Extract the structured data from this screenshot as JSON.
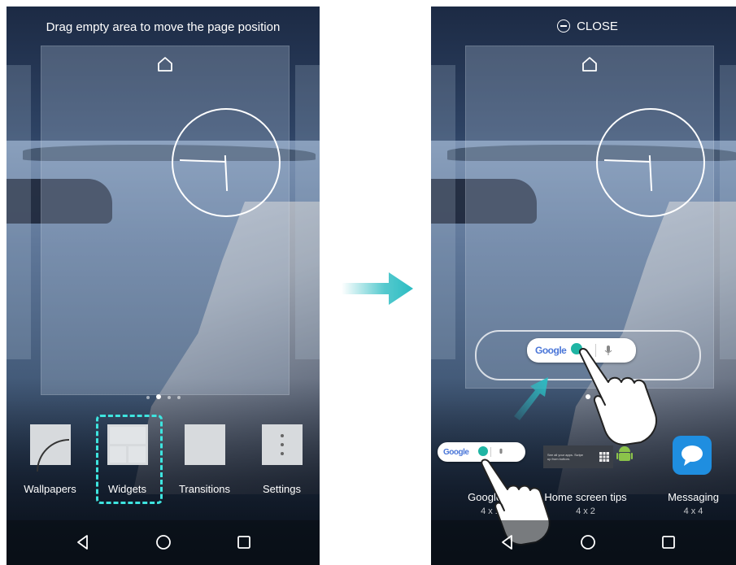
{
  "left_screen": {
    "hint": "Drag empty area to move the page position",
    "options": [
      {
        "label": "Wallpapers",
        "icon": "wallpaper-icon"
      },
      {
        "label": "Widgets",
        "icon": "widgets-icon",
        "highlighted": true
      },
      {
        "label": "Transitions",
        "icon": "transitions-icon"
      },
      {
        "label": "Settings",
        "icon": "settings-icon"
      }
    ],
    "page_count": 4,
    "active_page": 2
  },
  "right_screen": {
    "close_label": "CLOSE",
    "widgets": [
      {
        "label": "Google Q",
        "size": "4 x 1",
        "icon": "google-search-bar-icon"
      },
      {
        "label": "Home screen tips",
        "size": "4 x 2",
        "icon": "home-screen-tips-icon"
      },
      {
        "label": "Messaging",
        "size": "4 x 4",
        "icon": "messaging-icon"
      }
    ],
    "search_logo": "Google",
    "tips_text": "See all your apps. Swipe up from bottom."
  },
  "colors": {
    "highlight": "#3ee4df",
    "arrow": "#2bbcc2",
    "touch_dot": "#1fb5a4"
  },
  "icons": [
    "home-icon",
    "back-icon",
    "home-nav-icon",
    "recents-icon",
    "minus-circle-icon",
    "clock-widget-icon",
    "search-icon",
    "mic-icon",
    "hand-pointer-icon",
    "arrow-right-icon"
  ]
}
